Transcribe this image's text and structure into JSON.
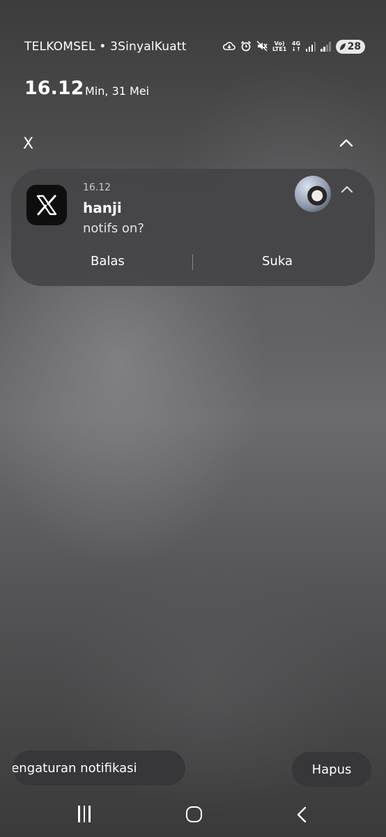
{
  "status_bar": {
    "carrier": "TELKOMSEL • 3SinyalKuatt",
    "volte_top": "Vo)",
    "volte_bottom": "LTE1",
    "network_type": "4G",
    "battery_level": "28",
    "icons": [
      "cloud-sync-icon",
      "alarm-icon",
      "mute-icon",
      "volte-icon",
      "signal-icon",
      "battery-icon"
    ]
  },
  "clock": {
    "time": "16.12",
    "date": "Min, 31 Mei"
  },
  "notification_group": {
    "app_name": "X",
    "notification": {
      "time": "16.12",
      "sender": "hanji",
      "message": "notifs on?",
      "actions": [
        "Balas",
        "Suka"
      ]
    }
  },
  "bottom": {
    "settings_label": "Pengaturan notifikasi",
    "clear_label": "Hapus"
  },
  "colors": {
    "card": "#444446",
    "pill": "#373739",
    "text": "#ffffff"
  }
}
